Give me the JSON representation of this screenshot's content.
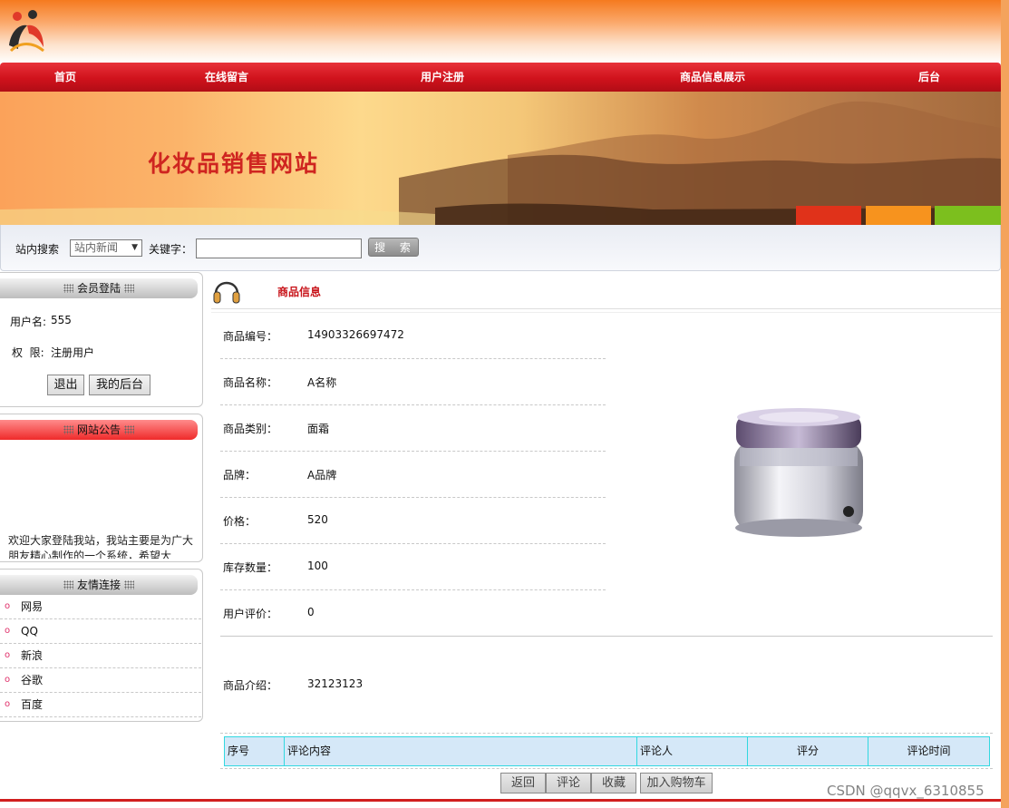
{
  "nav": {
    "items": [
      "首页",
      "在线留言",
      "用户注册",
      "商品信息展示",
      "后台"
    ]
  },
  "banner": {
    "title": "化妆品销售网站"
  },
  "search": {
    "label": "站内搜索",
    "select_value": "站内新闻",
    "keyword_label": "关键字：",
    "keyword_value": "",
    "button_label": "搜 索"
  },
  "login_panel": {
    "title": "会员登陆",
    "username_label": "用户名:",
    "username_value": "555",
    "role_label": "权  限:",
    "role_value": "注册用户",
    "logout_button": "退出",
    "my_backend_button": "我的后台"
  },
  "notice_panel": {
    "title": "网站公告",
    "text": "欢迎大家登陆我站，我站主要是为广大朋友精心制作的一个系统，希望大"
  },
  "links_panel": {
    "title": "友情连接",
    "items": [
      "网易",
      "QQ",
      "新浪",
      "谷歌",
      "百度"
    ]
  },
  "main": {
    "title": "商品信息",
    "fields": [
      {
        "label": "商品编号：",
        "value": "14903326697472"
      },
      {
        "label": "商品名称：",
        "value": "A名称"
      },
      {
        "label": "商品类别：",
        "value": "面霜"
      },
      {
        "label": "品牌：",
        "value": "A品牌"
      },
      {
        "label": "价格：",
        "value": "520"
      },
      {
        "label": "库存数量：",
        "value": "100"
      },
      {
        "label": "用户评价：",
        "value": "0"
      }
    ],
    "intro_label": "商品介绍：",
    "intro_value": "32123123",
    "review_headers": [
      "序号",
      "评论内容",
      "评论人",
      "评分",
      "评论时间"
    ],
    "actions": [
      "返回",
      "评论",
      "收藏",
      "加入购物车"
    ]
  },
  "watermark": "CSDN @qqvx_6310855",
  "colors": {
    "nav_red": "#d0121c",
    "title_red": "#c8151b",
    "table_header_bg": "#d5e8f8",
    "table_border": "#32d8e0"
  }
}
